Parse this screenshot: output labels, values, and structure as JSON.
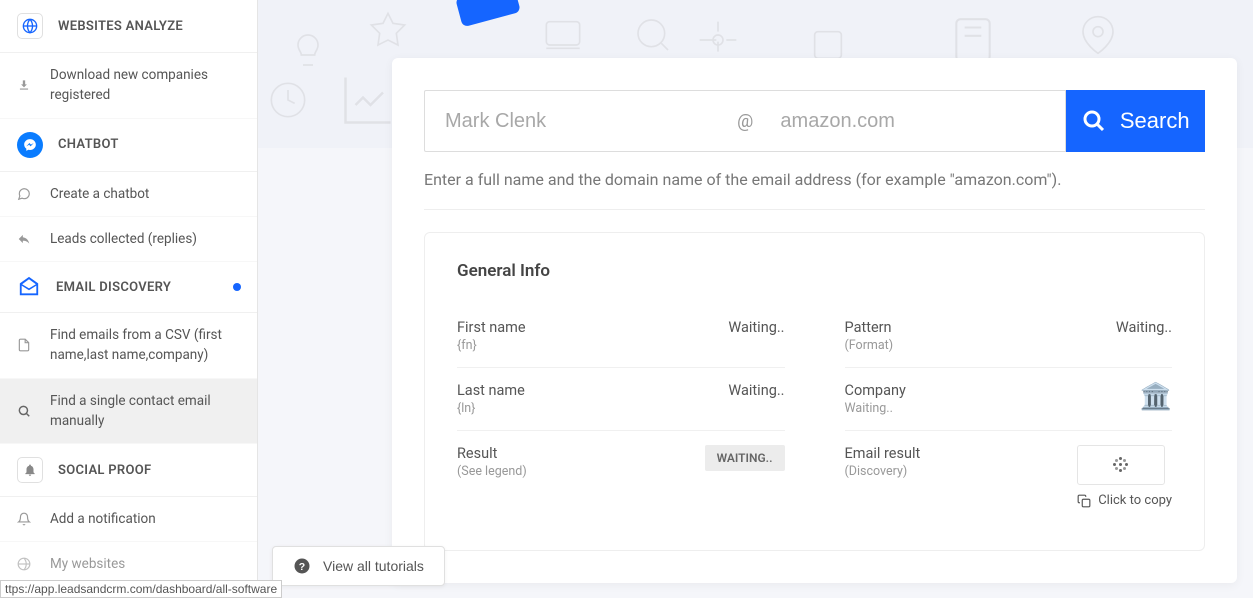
{
  "sidebar": {
    "sections": {
      "websites_analyze": "WEBSITES ANALYZE",
      "chatbot": "CHATBOT",
      "email_discovery": "EMAIL DISCOVERY",
      "social_proof": "SOCIAL PROOF"
    },
    "items": {
      "download_companies": "Download new companies registered",
      "create_chatbot": "Create a chatbot",
      "leads_collected": "Leads collected (replies)",
      "find_emails_csv": "Find emails from a CSV (first name,last name,company)",
      "find_single_email": "Find a single contact email manually",
      "add_notification": "Add a notification",
      "my_websites": "My websites"
    }
  },
  "search": {
    "name_placeholder": "Mark Clenk",
    "at_symbol": "@",
    "domain_placeholder": "amazon.com",
    "button_label": "Search",
    "help_text": "Enter a full name and the domain name of the email address (for example \"amazon.com\")."
  },
  "info": {
    "title": "General Info",
    "rows": {
      "first_name": {
        "label": "First name",
        "sub": "{fn}",
        "value": "Waiting.."
      },
      "last_name": {
        "label": "Last name",
        "sub": "{ln}",
        "value": "Waiting.."
      },
      "result": {
        "label": "Result",
        "sub": "(See legend)",
        "badge": "WAITING.."
      },
      "pattern": {
        "label": "Pattern",
        "sub": "(Format)",
        "value": "Waiting.."
      },
      "company": {
        "label": "Company",
        "sub": "Waiting.."
      },
      "email_result": {
        "label": "Email result",
        "sub": "(Discovery)",
        "copy_label": "Click to copy"
      }
    }
  },
  "tutorials_button": "View all tutorials",
  "status_url": "ttps://app.leadsandcrm.com/dashboard/all-software"
}
